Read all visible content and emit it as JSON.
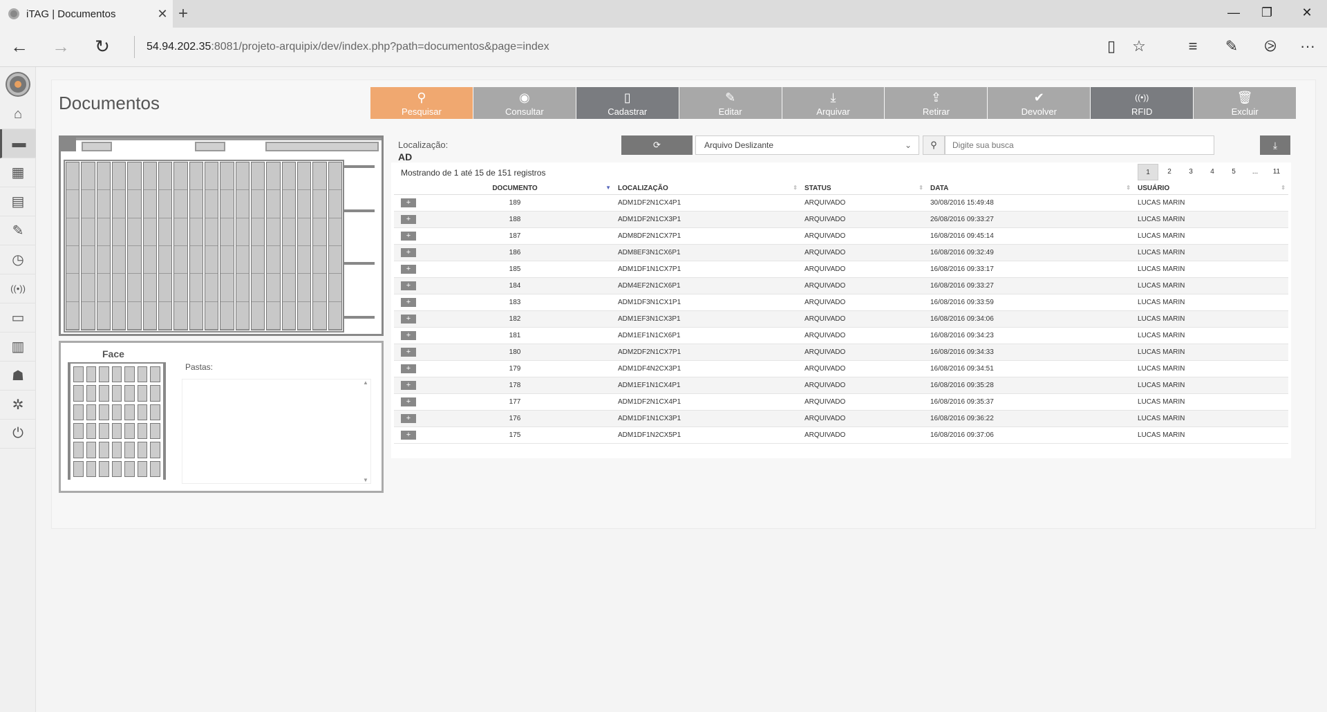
{
  "browser": {
    "tab_title": "iTAG | Documentos",
    "tab_close": "✕",
    "new_tab": "+",
    "url_host": "54.94.202.35",
    "url_rest": ":8081/projeto-arquipix/dev/index.php?path=documentos&page=index",
    "minimize": "—",
    "restore": "❐",
    "close": "✕",
    "back": "←",
    "forward": "→",
    "refresh": "↻",
    "reading_view": "▯",
    "favorite": "☆",
    "hub": "≡",
    "note": "✎",
    "share": "⧁",
    "more": "···"
  },
  "sidebar": {
    "items": [
      {
        "name": "home-icon",
        "glyph": "⌂"
      },
      {
        "name": "archive-icon",
        "glyph": "▬"
      },
      {
        "name": "shelf-icon",
        "glyph": "▦"
      },
      {
        "name": "document-icon",
        "glyph": "▤"
      },
      {
        "name": "edit-icon",
        "glyph": "✎"
      },
      {
        "name": "clock-icon",
        "glyph": "◷"
      },
      {
        "name": "rfid-icon",
        "glyph": "((•))"
      },
      {
        "name": "monitor-icon",
        "glyph": "▭"
      },
      {
        "name": "clipboard-icon",
        "glyph": "▥"
      },
      {
        "name": "users-icon",
        "glyph": "☗"
      },
      {
        "name": "settings-icon",
        "glyph": "✲"
      },
      {
        "name": "power-icon",
        "glyph": "⏻"
      }
    ]
  },
  "page": {
    "title": "Documentos",
    "toolbar": [
      {
        "label": "Pesquisar",
        "icon": "⚲",
        "style": "primary",
        "name": "search-button"
      },
      {
        "label": "Consultar",
        "icon": "◉",
        "style": "normal",
        "name": "consult-button"
      },
      {
        "label": "Cadastrar",
        "icon": "▯",
        "style": "dark",
        "name": "register-button"
      },
      {
        "label": "Editar",
        "icon": "✎",
        "style": "normal",
        "name": "edit-button"
      },
      {
        "label": "Arquivar",
        "icon": "⤓",
        "style": "normal",
        "name": "archive-button"
      },
      {
        "label": "Retirar",
        "icon": "⇪",
        "style": "normal",
        "name": "withdraw-button"
      },
      {
        "label": "Devolver",
        "icon": "✔",
        "style": "normal",
        "name": "return-button"
      },
      {
        "label": "RFID",
        "icon": "((•))",
        "style": "dark",
        "name": "rfid-button"
      },
      {
        "label": "Excluir",
        "icon": "🗑",
        "style": "normal",
        "name": "delete-button"
      }
    ],
    "location_label": "Localização:",
    "location_value": "AD",
    "refresh_icon": "⟳",
    "select_value": "Arquivo Deslizante",
    "select_chevron": "⌄",
    "search_placeholder": "Digite sua busca",
    "search_icon": "⚲",
    "download_icon": "⤓",
    "face_title": "Face",
    "pastas_label": "Pastas:",
    "scroll_up": "▲",
    "scroll_down": "▼"
  },
  "table": {
    "records_info": "Mostrando de 1 até 15 de 151 registros",
    "pages": [
      "1",
      "2",
      "3",
      "4",
      "5",
      "...",
      "11"
    ],
    "active_page": "1",
    "columns": [
      "DOCUMENTO",
      "LOCALIZAÇÃO",
      "STATUS",
      "DATA",
      "USUÁRIO"
    ],
    "rows": [
      [
        "189",
        "ADM1DF2N1CX4P1",
        "ARQUIVADO",
        "30/08/2016 15:49:48",
        "LUCAS MARIN"
      ],
      [
        "188",
        "ADM1DF2N1CX3P1",
        "ARQUIVADO",
        "26/08/2016 09:33:27",
        "LUCAS MARIN"
      ],
      [
        "187",
        "ADM8DF2N1CX7P1",
        "ARQUIVADO",
        "16/08/2016 09:45:14",
        "LUCAS MARIN"
      ],
      [
        "186",
        "ADM8EF3N1CX6P1",
        "ARQUIVADO",
        "16/08/2016 09:32:49",
        "LUCAS MARIN"
      ],
      [
        "185",
        "ADM1DF1N1CX7P1",
        "ARQUIVADO",
        "16/08/2016 09:33:17",
        "LUCAS MARIN"
      ],
      [
        "184",
        "ADM4EF2N1CX6P1",
        "ARQUIVADO",
        "16/08/2016 09:33:27",
        "LUCAS MARIN"
      ],
      [
        "183",
        "ADM1DF3N1CX1P1",
        "ARQUIVADO",
        "16/08/2016 09:33:59",
        "LUCAS MARIN"
      ],
      [
        "182",
        "ADM1EF3N1CX3P1",
        "ARQUIVADO",
        "16/08/2016 09:34:06",
        "LUCAS MARIN"
      ],
      [
        "181",
        "ADM1EF1N1CX6P1",
        "ARQUIVADO",
        "16/08/2016 09:34:23",
        "LUCAS MARIN"
      ],
      [
        "180",
        "ADM2DF2N1CX7P1",
        "ARQUIVADO",
        "16/08/2016 09:34:33",
        "LUCAS MARIN"
      ],
      [
        "179",
        "ADM1DF4N2CX3P1",
        "ARQUIVADO",
        "16/08/2016 09:34:51",
        "LUCAS MARIN"
      ],
      [
        "178",
        "ADM1EF1N1CX4P1",
        "ARQUIVADO",
        "16/08/2016 09:35:28",
        "LUCAS MARIN"
      ],
      [
        "177",
        "ADM1DF2N1CX4P1",
        "ARQUIVADO",
        "16/08/2016 09:35:37",
        "LUCAS MARIN"
      ],
      [
        "176",
        "ADM1DF1N1CX3P1",
        "ARQUIVADO",
        "16/08/2016 09:36:22",
        "LUCAS MARIN"
      ],
      [
        "175",
        "ADM1DF1N2CX5P1",
        "ARQUIVADO",
        "16/08/2016 09:37:06",
        "LUCAS MARIN"
      ]
    ],
    "expand_label": "+",
    "sort_icon": "⇕",
    "sort_active_icon": "▼"
  },
  "colors": {
    "primary": "#f0a870",
    "dark_button": "#7a7c80",
    "button": "#a8a8a8"
  }
}
